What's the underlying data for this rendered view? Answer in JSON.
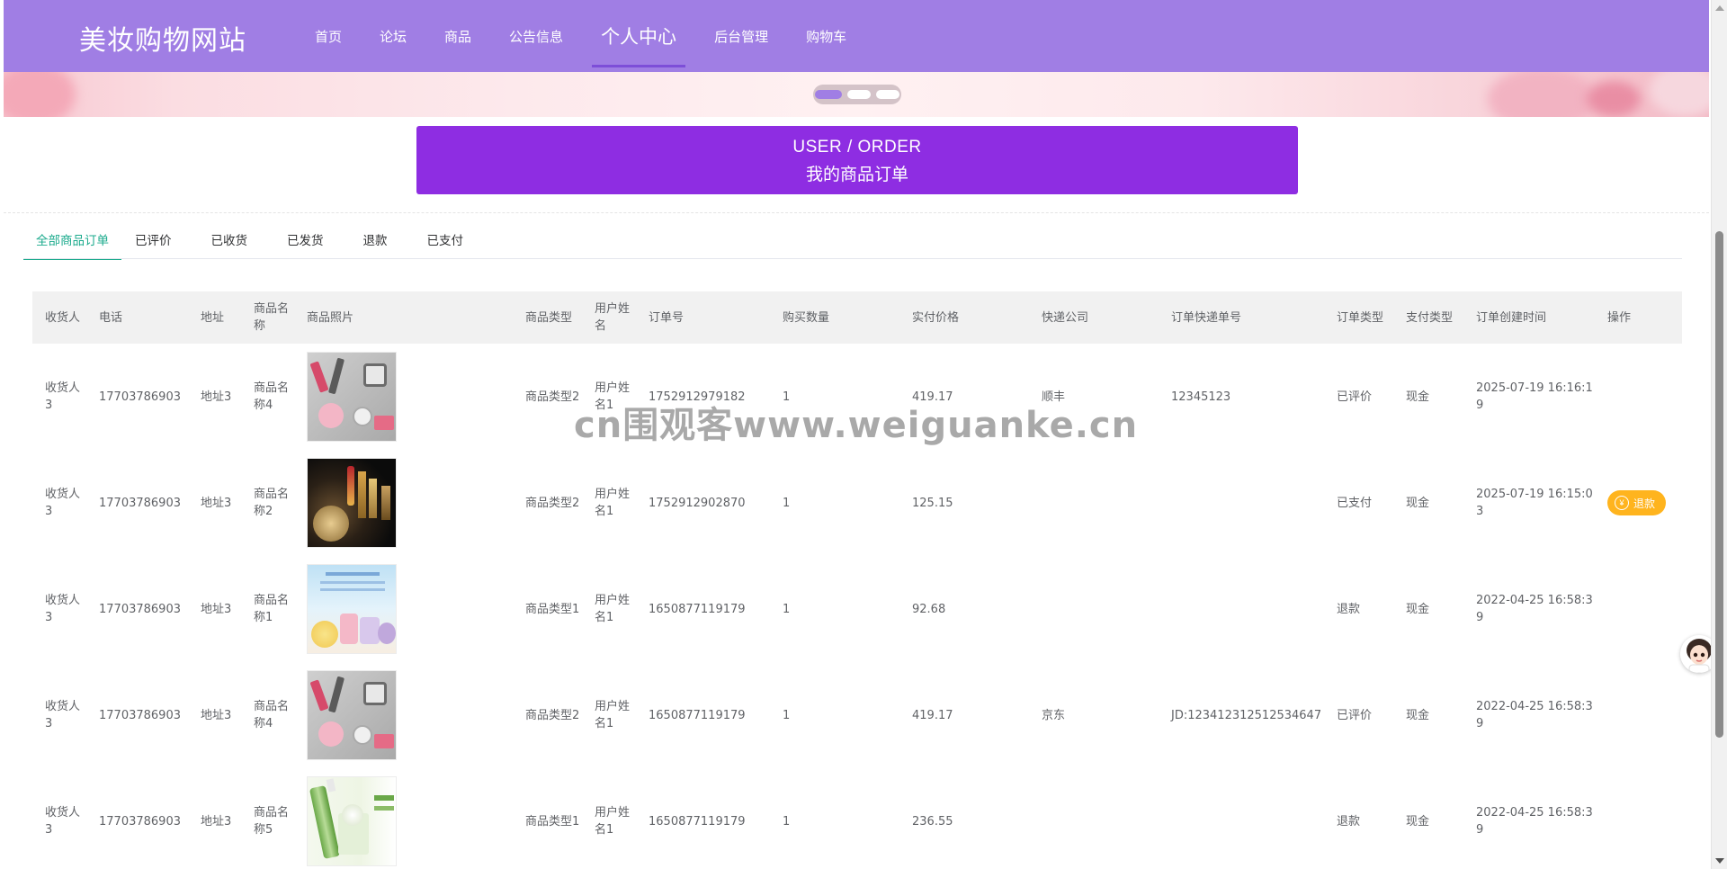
{
  "header": {
    "brand": "美妆购物网站",
    "nav": [
      "首页",
      "论坛",
      "商品",
      "公告信息",
      "个人中心",
      "后台管理",
      "购物车"
    ],
    "active_index": 4,
    "bg_color": "#a07ee4"
  },
  "banner": {
    "dots": 3,
    "active_dot": 0
  },
  "page_title": {
    "en": "USER / ORDER",
    "cn": "我的商品订单",
    "bg_color": "#8e2de2"
  },
  "tabs": [
    "全部商品订单",
    "已评价",
    "已收货",
    "已发货",
    "退款",
    "已支付"
  ],
  "active_tab": 0,
  "table": {
    "headers": [
      "收货人",
      "电话",
      "地址",
      "商品名称",
      "商品照片",
      "商品类型",
      "用户姓名",
      "订单号",
      "购买数量",
      "实付价格",
      "快递公司",
      "订单快递单号",
      "订单类型",
      "支付类型",
      "订单创建时间",
      "操作"
    ],
    "rows": [
      {
        "receiver": "收货人3",
        "phone": "17703786903",
        "address": "地址3",
        "product": "商品名称4",
        "image": "cosmetics-set-icon",
        "type": "商品类型2",
        "user": "用户姓名1",
        "order_no": "1752912979182",
        "qty": "1",
        "price": "419.17",
        "courier": "顺丰",
        "tracking": "12345123",
        "status": "已评价",
        "pay": "现金",
        "created": "2025-07-19 16:16:19",
        "action": ""
      },
      {
        "receiver": "收货人3",
        "phone": "17703786903",
        "address": "地址3",
        "product": "商品名称2",
        "image": "lipstick-icon",
        "type": "商品类型2",
        "user": "用户姓名1",
        "order_no": "1752912902870",
        "qty": "1",
        "price": "125.15",
        "courier": "",
        "tracking": "",
        "status": "已支付",
        "pay": "现金",
        "created": "2025-07-19 16:15:03",
        "action": "退款"
      },
      {
        "receiver": "收货人3",
        "phone": "17703786903",
        "address": "地址3",
        "product": "商品名称1",
        "image": "perfume-icon",
        "type": "商品类型1",
        "user": "用户姓名1",
        "order_no": "1650877119179",
        "qty": "1",
        "price": "92.68",
        "courier": "",
        "tracking": "",
        "status": "退款",
        "pay": "现金",
        "created": "2022-04-25 16:58:39",
        "action": ""
      },
      {
        "receiver": "收货人3",
        "phone": "17703786903",
        "address": "地址3",
        "product": "商品名称4",
        "image": "cosmetics-set-icon",
        "type": "商品类型2",
        "user": "用户姓名1",
        "order_no": "1650877119179",
        "qty": "1",
        "price": "419.17",
        "courier": "京东",
        "tracking": "JD:123412312512534647",
        "status": "已评价",
        "pay": "现金",
        "created": "2022-04-25 16:58:39",
        "action": ""
      },
      {
        "receiver": "收货人3",
        "phone": "17703786903",
        "address": "地址3",
        "product": "商品名称5",
        "image": "skincare-icon",
        "type": "商品类型1",
        "user": "用户姓名1",
        "order_no": "1650877119179",
        "qty": "1",
        "price": "236.55",
        "courier": "",
        "tracking": "",
        "status": "退款",
        "pay": "现金",
        "created": "2022-04-25 16:58:39",
        "action": ""
      }
    ]
  },
  "watermark": "cn围观客www.weiguanke.cn",
  "colors": {
    "accent_tab": "#1aaa8c",
    "refund_button": "#ffb41e"
  }
}
